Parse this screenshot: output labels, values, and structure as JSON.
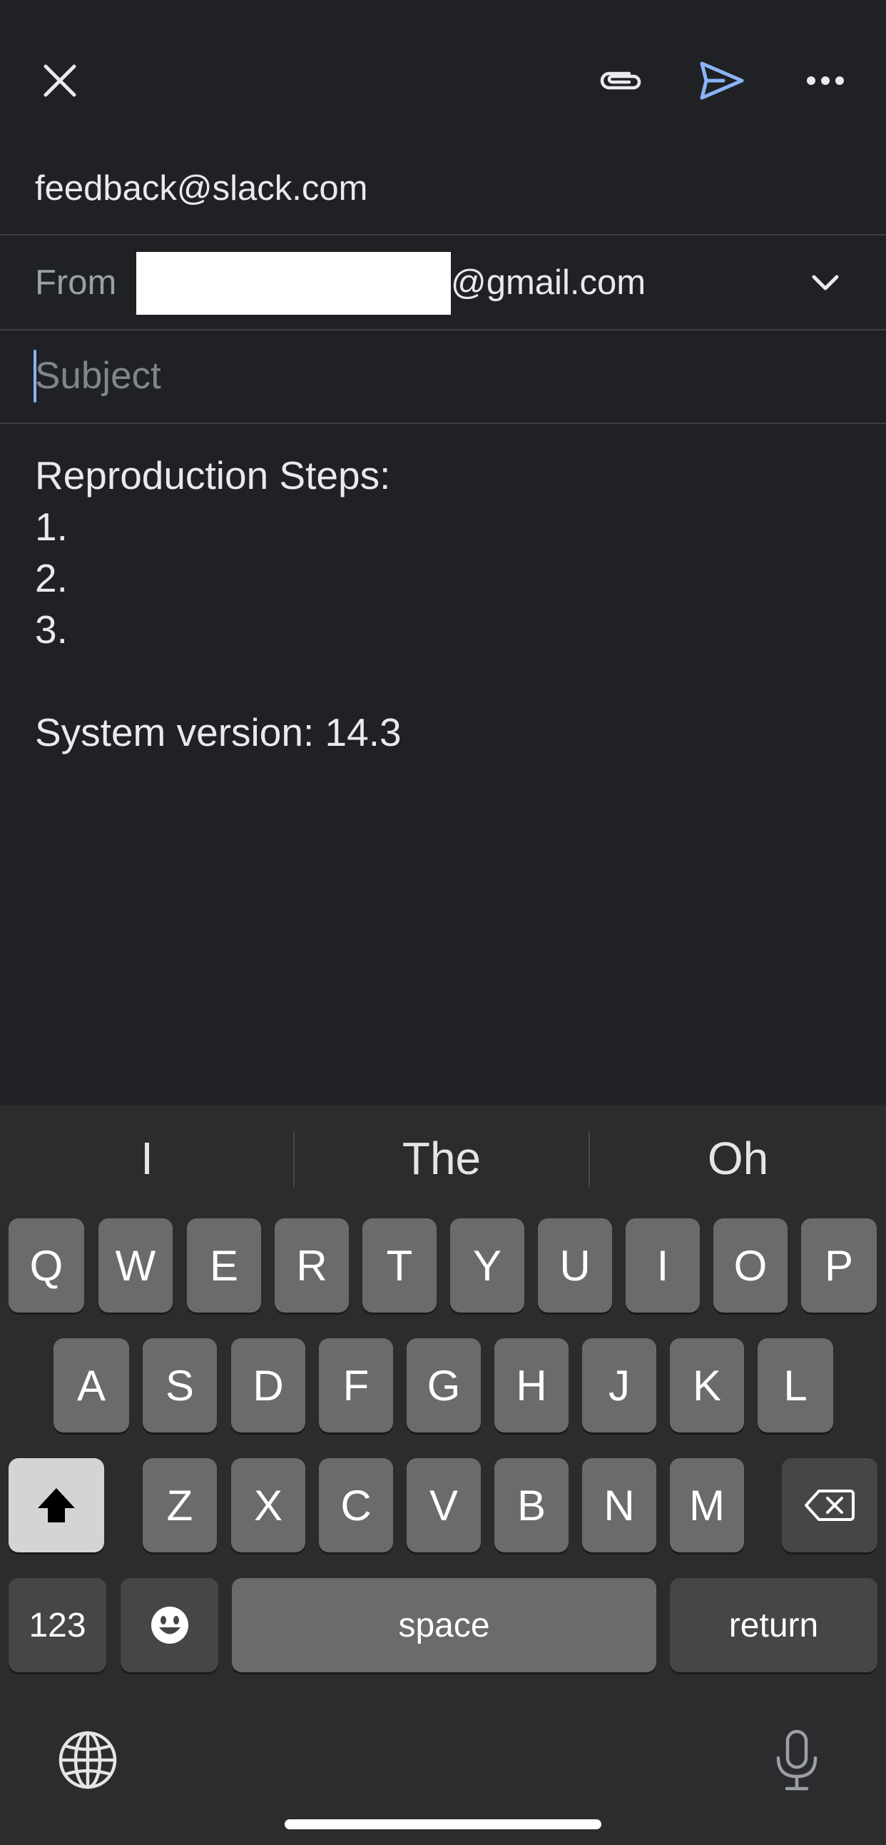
{
  "toolbar": {
    "close_icon": "close-icon",
    "attach_icon": "paperclip-icon",
    "send_icon": "send-icon",
    "more_icon": "more-horizontal-icon",
    "accent": "#8ab4f8"
  },
  "compose": {
    "to": "feedback@slack.com",
    "from_label": "From",
    "from_domain": "@gmail.com",
    "subject_placeholder": "Subject",
    "body_lines": [
      "Reproduction Steps:",
      "1.",
      "2.",
      "3.",
      "",
      "System version: 14.3"
    ]
  },
  "keyboard": {
    "suggestions": [
      "I",
      "The",
      "Oh"
    ],
    "row1": [
      "Q",
      "W",
      "E",
      "R",
      "T",
      "Y",
      "U",
      "I",
      "O",
      "P"
    ],
    "row2": [
      "A",
      "S",
      "D",
      "F",
      "G",
      "H",
      "J",
      "K",
      "L"
    ],
    "row3": [
      "Z",
      "X",
      "C",
      "V",
      "B",
      "N",
      "M"
    ],
    "numbers_label": "123",
    "space_label": "space",
    "return_label": "return"
  }
}
